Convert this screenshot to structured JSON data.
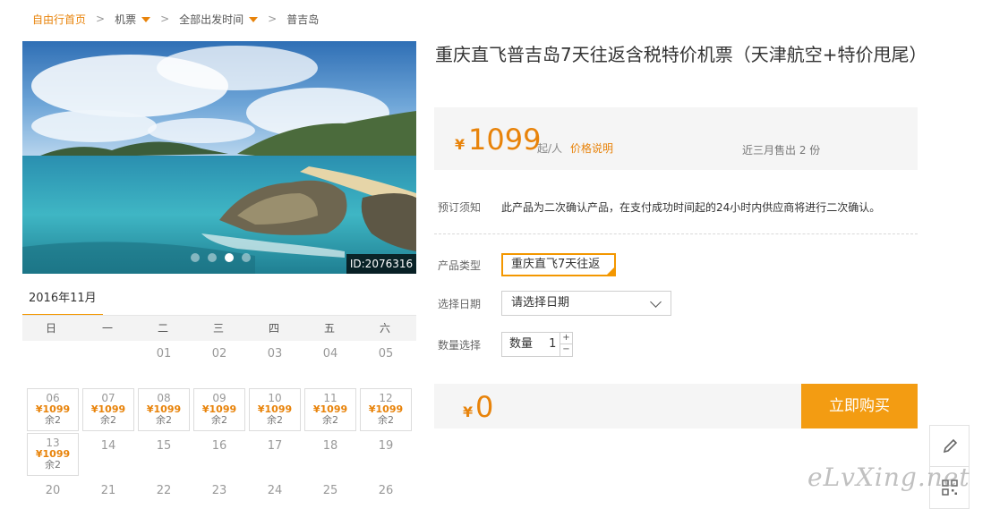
{
  "breadcrumb": {
    "home": "自由行首页",
    "sep": ">",
    "flights": "机票",
    "departure": "全部出发时间",
    "destination": "普吉岛"
  },
  "hero": {
    "image_id": "ID:2076316",
    "slides": 4,
    "active_slide": 3
  },
  "calendar": {
    "month": "2016年11月",
    "weekdays": [
      "日",
      "一",
      "二",
      "三",
      "四",
      "五",
      "六"
    ],
    "days": [
      {
        "num": "01",
        "price": "",
        "remaining": ""
      },
      {
        "num": "02",
        "price": "",
        "remaining": ""
      },
      {
        "num": "03",
        "price": "",
        "remaining": ""
      },
      {
        "num": "04",
        "price": "",
        "remaining": ""
      },
      {
        "num": "05",
        "price": "",
        "remaining": ""
      },
      {
        "num": "06",
        "price": "¥1099",
        "remaining": "余2"
      },
      {
        "num": "07",
        "price": "¥1099",
        "remaining": "余2"
      },
      {
        "num": "08",
        "price": "¥1099",
        "remaining": "余2"
      },
      {
        "num": "09",
        "price": "¥1099",
        "remaining": "余2"
      },
      {
        "num": "10",
        "price": "¥1099",
        "remaining": "余2"
      },
      {
        "num": "11",
        "price": "¥1099",
        "remaining": "余2"
      },
      {
        "num": "12",
        "price": "¥1099",
        "remaining": "余2"
      },
      {
        "num": "13",
        "price": "¥1099",
        "remaining": "余2"
      },
      {
        "num": "14",
        "price": "",
        "remaining": ""
      },
      {
        "num": "15",
        "price": "",
        "remaining": ""
      },
      {
        "num": "16",
        "price": "",
        "remaining": ""
      },
      {
        "num": "17",
        "price": "",
        "remaining": ""
      },
      {
        "num": "18",
        "price": "",
        "remaining": ""
      },
      {
        "num": "19",
        "price": "",
        "remaining": ""
      },
      {
        "num": "20",
        "price": "",
        "remaining": ""
      },
      {
        "num": "21",
        "price": "",
        "remaining": ""
      },
      {
        "num": "22",
        "price": "",
        "remaining": ""
      },
      {
        "num": "23",
        "price": "",
        "remaining": ""
      },
      {
        "num": "24",
        "price": "",
        "remaining": ""
      },
      {
        "num": "25",
        "price": "",
        "remaining": ""
      },
      {
        "num": "26",
        "price": "",
        "remaining": ""
      }
    ]
  },
  "product": {
    "title": "重庆直飞普吉岛7天往返含税特价机票（天津航空+特价甩尾）",
    "currency": "¥",
    "price": "1099",
    "price_unit": "起/人",
    "price_note": "价格说明",
    "sold": "近三月售出 2 份",
    "notice_label": "预订须知",
    "notice_text": "此产品为二次确认产品，在支付成功时间起的24小时内供应商将进行二次确认。",
    "type_label": "产品类型",
    "type_value": "重庆直飞7天往返",
    "date_label": "选择日期",
    "date_placeholder": "请选择日期",
    "qty_label": "数量选择",
    "qty_prefix": "数量",
    "qty_value": "1",
    "qty_plus": "+",
    "qty_minus": "−",
    "total": "0",
    "buy_label": "立即购买"
  },
  "watermark": "eLvXing.net",
  "colors": {
    "accent": "#f39700",
    "price": "#e8830a"
  }
}
